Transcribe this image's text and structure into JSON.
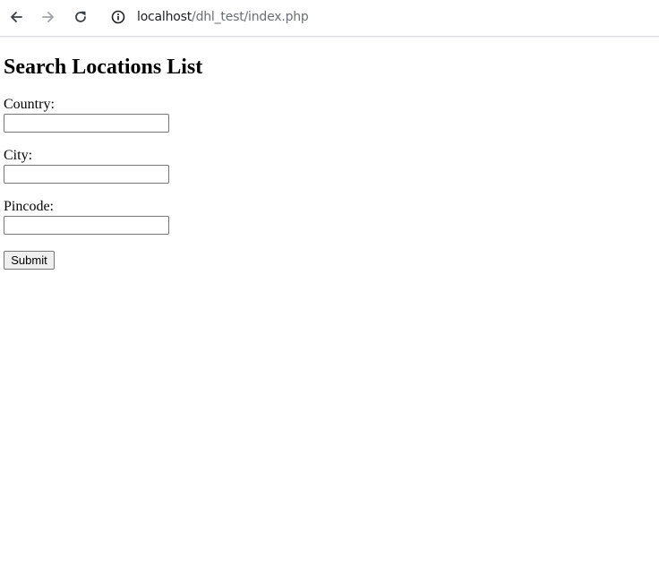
{
  "browser": {
    "icons": {
      "back": "arrow-left-icon",
      "forward": "arrow-right-icon",
      "reload": "reload-icon",
      "site_info": "info-icon"
    },
    "url_host": "localhost",
    "url_path": "/dhl_test/index.php"
  },
  "form": {
    "title": "Search Locations List",
    "fields": [
      {
        "label": "Country:",
        "value": ""
      },
      {
        "label": "City:",
        "value": ""
      },
      {
        "label": "Pincode:",
        "value": ""
      }
    ],
    "submit_label": "Submit"
  },
  "colors": {
    "url_host": "#202124",
    "url_path": "#6b6f73",
    "toolbar_icon": "#3c4043",
    "toolbar_icon_disabled": "#a0a4a8"
  }
}
